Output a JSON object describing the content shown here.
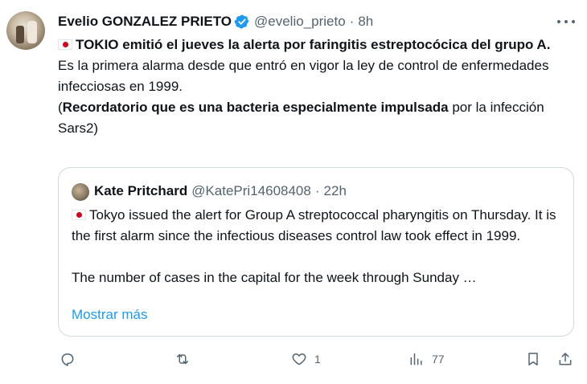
{
  "tweet": {
    "author_name": "Evelio GONZALEZ PRIETO",
    "handle": "@evelio_prieto",
    "separator": "·",
    "time": "8h",
    "headline": "TOKIO emitió el jueves la alerta por faringitis estreptocócica del grupo A.",
    "line2": "Es la primera alarma desde que entró en vigor la ley de control de enfermedades infecciosas en 1999.",
    "line3_open": "(",
    "line3_bold": "Recordatorio que es una bacteria especialmente impulsada",
    "line3_rest": " por la infección Sars2)"
  },
  "quote": {
    "author_name": "Kate Pritchard",
    "handle": "@KatePri14608408",
    "separator": "·",
    "time": "22h",
    "paragraph1": "Tokyo issued the alert for Group A streptococcal pharyngitis on Thursday. It is the first alarm since the infectious diseases control law took effect in 1999.",
    "paragraph2": "The number of cases in the capital for the week through Sunday …",
    "show_more": "Mostrar más"
  },
  "actions": {
    "reply_count": "",
    "retweet_count": "",
    "like_count": "1",
    "views_count": "77"
  },
  "icons": {
    "verified": "verified-badge-icon",
    "flag": "japan-flag-icon",
    "more": "more-dots-icon",
    "reply": "reply-icon",
    "retweet": "retweet-icon",
    "like": "heart-icon",
    "views": "views-chart-icon",
    "bookmark": "bookmark-icon",
    "share": "share-icon"
  },
  "colors": {
    "link": "#1d9bf0",
    "muted": "#536471",
    "verified": "#1d9bf0",
    "flag_red": "#d0021b"
  }
}
